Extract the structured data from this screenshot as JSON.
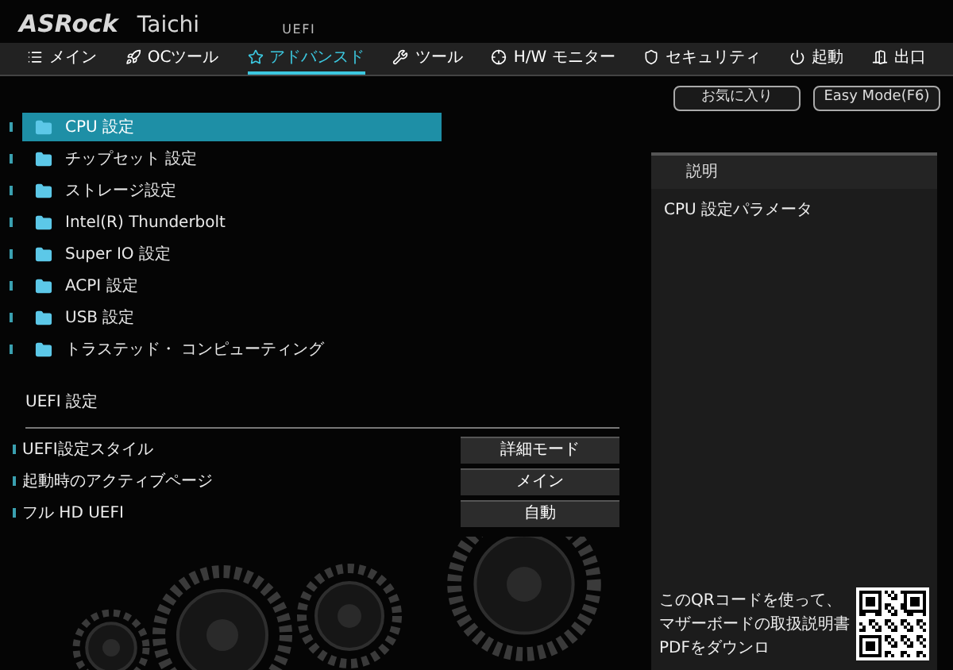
{
  "header": {
    "brand": "ASRock",
    "model": "Taichi",
    "mode": "UEFI"
  },
  "tabs": [
    {
      "label": "メイン",
      "selected": false
    },
    {
      "label": "OCツール",
      "selected": false
    },
    {
      "label": "アドバンスド",
      "selected": true
    },
    {
      "label": "ツール",
      "selected": false
    },
    {
      "label": "H/W モニター",
      "selected": false
    },
    {
      "label": "セキュリティ",
      "selected": false
    },
    {
      "label": "起動",
      "selected": false
    },
    {
      "label": "出口",
      "selected": false
    }
  ],
  "top_buttons": [
    "お気に入り",
    "Easy Mode(F6)"
  ],
  "menu": [
    {
      "label": "CPU 設定",
      "selected": true
    },
    {
      "label": "チップセット 設定",
      "selected": false
    },
    {
      "label": "ストレージ設定",
      "selected": false
    },
    {
      "label": "Intel(R) Thunderbolt",
      "selected": false
    },
    {
      "label": "Super IO 設定",
      "selected": false
    },
    {
      "label": "ACPI 設定",
      "selected": false
    },
    {
      "label": "USB 設定",
      "selected": false
    },
    {
      "label": "トラステッド・ コンピューティング",
      "selected": false
    }
  ],
  "section": {
    "title": "UEFI 設定",
    "settings": [
      {
        "label": "UEFI設定スタイル",
        "value": "詳細モード"
      },
      {
        "label": "起動時のアクティブページ",
        "value": "メイン"
      },
      {
        "label": "フル HD UEFI",
        "value": "自動"
      }
    ]
  },
  "description": {
    "title": "説明",
    "text": "CPU 設定パラメータ",
    "qr_text": "このQRコードを使って、マザーボードの取扱説明書PDFをダウンロ"
  }
}
